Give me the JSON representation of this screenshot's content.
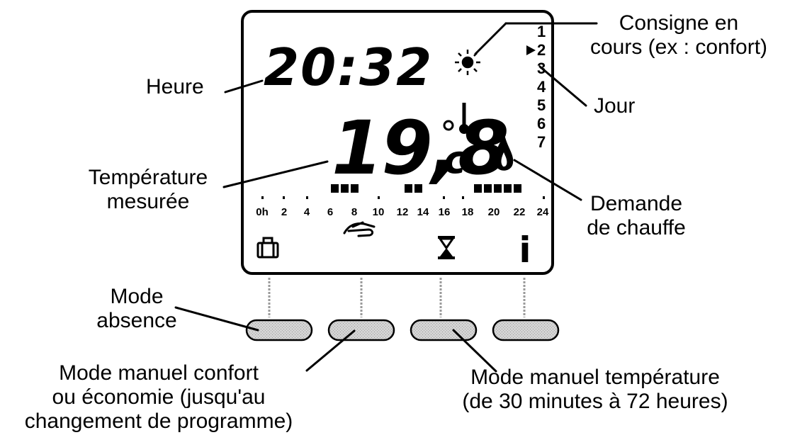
{
  "display": {
    "time": "20:32",
    "temperature": "19,8",
    "temperature_unit": "c",
    "day_numbers": [
      "1",
      "2",
      "3",
      "4",
      "5",
      "6",
      "7"
    ],
    "current_day": "2",
    "hour_ticks": [
      "0h",
      "2",
      "4",
      "6",
      "8",
      "10",
      "12",
      "14",
      "16",
      "18",
      "20",
      "22",
      "24"
    ],
    "info_symbol": "i"
  },
  "icons": [
    "sun-icon",
    "thermometer-icon",
    "flame-icon",
    "suitcase-icon",
    "hand-icon",
    "hourglass-icon",
    "info-icon",
    "day-pointer-icon"
  ],
  "labels": {
    "heure": "Heure",
    "temperature_line1": "Température",
    "temperature_line2": "mesurée",
    "consigne_line1": "Consigne en",
    "consigne_line2": "cours (ex : confort)",
    "jour": "Jour",
    "demande_line1": "Demande",
    "demande_line2": "de chauffe",
    "absence_line1": "Mode",
    "absence_line2": "absence",
    "manuel_confort_line1": "Mode manuel confort",
    "manuel_confort_line2": "ou économie (jusqu'au",
    "manuel_confort_line3": "changement de programme)",
    "manuel_temp_line1": "Mode manuel température",
    "manuel_temp_line2": "(de 30 minutes à 72 heures)"
  },
  "colors": {
    "ink": "#000000",
    "button_fill": "#cfcfcf",
    "connector": "#9a9a9a"
  }
}
